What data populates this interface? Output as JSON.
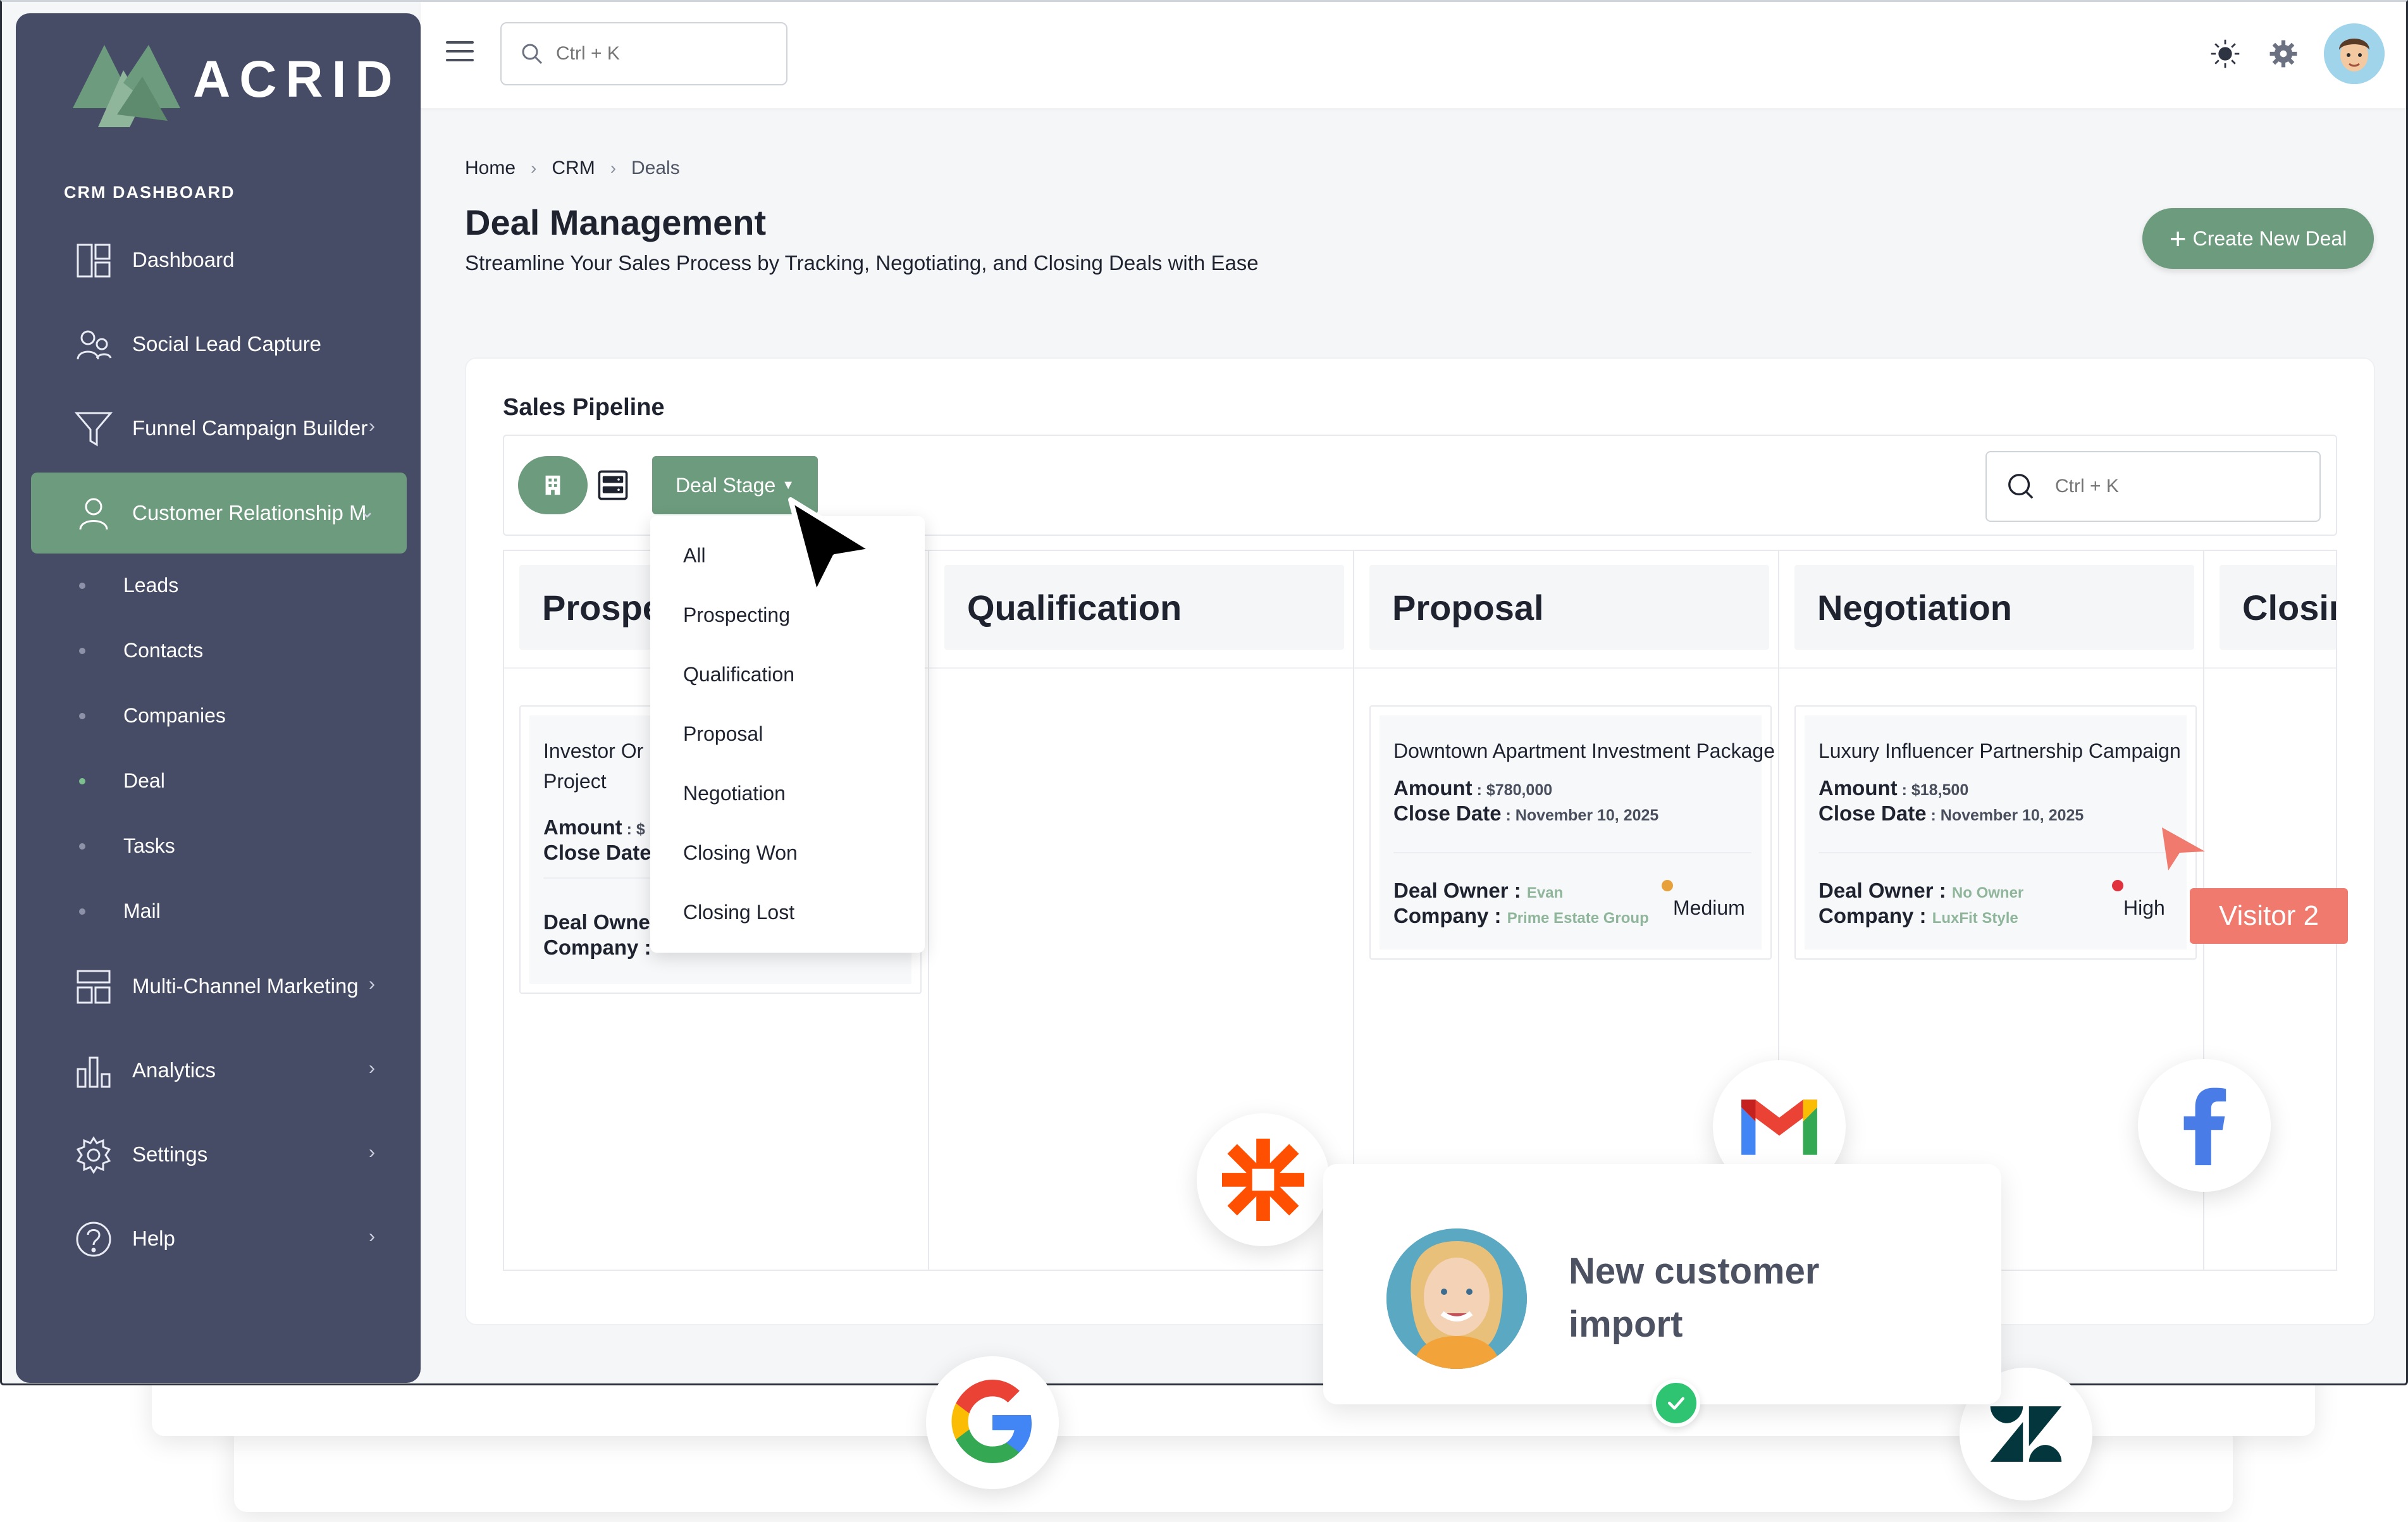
{
  "brand": {
    "name": "ACRID"
  },
  "sidebar": {
    "section_title": "CRM DASHBOARD",
    "items": [
      {
        "label": "Dashboard"
      },
      {
        "label": "Social Lead Capture"
      },
      {
        "label": "Funnel Campaign Builder"
      },
      {
        "label": "Customer Relationship M"
      },
      {
        "label": "Multi-Channel Marketing"
      },
      {
        "label": "Analytics"
      },
      {
        "label": "Settings"
      },
      {
        "label": "Help"
      }
    ],
    "sub_items": [
      {
        "label": "Leads"
      },
      {
        "label": "Contacts"
      },
      {
        "label": "Companies"
      },
      {
        "label": "Deal"
      },
      {
        "label": "Tasks"
      },
      {
        "label": "Mail"
      }
    ]
  },
  "topbar": {
    "search_placeholder": "Ctrl + K"
  },
  "breadcrumb": [
    "Home",
    "CRM",
    "Deals"
  ],
  "page": {
    "title": "Deal Management",
    "subtitle": "Streamline Your Sales Process by Tracking, Negotiating, and Closing Deals with Ease",
    "create_button": "Create New Deal"
  },
  "pipeline": {
    "title": "Sales Pipeline",
    "filter_label": "Deal Stage",
    "search_placeholder": "Ctrl + K",
    "columns": [
      "Prospecting",
      "Qualification",
      "Proposal",
      "Negotiation",
      "Closing Won"
    ],
    "dropdown_options": [
      "All",
      "Prospecting",
      "Qualification",
      "Proposal",
      "Negotiation",
      "Closing Won",
      "Closing Lost"
    ],
    "labels": {
      "amount": "Amount",
      "close_date": "Close Date",
      "deal_owner": "Deal Owner",
      "company": "Company"
    },
    "cards": [
      {
        "title_line1": "Investor Or",
        "title_line2": "Project",
        "amount": "$",
        "close_date": "",
        "owner": "",
        "company": ""
      },
      {
        "title": "Downtown Apartment Investment Package",
        "amount": "$780,000",
        "close_date": "November 10, 2025",
        "owner": "Evan",
        "company": "Prime Estate Group",
        "priority": "Medium",
        "priority_color": "#e8a13a"
      },
      {
        "title": "Luxury Influencer Partnership Campaign",
        "amount": "$18,500",
        "close_date": "November 10, 2025",
        "owner": "No Owner",
        "company": "LuxFit Style",
        "priority": "High",
        "priority_color": "#e0313c"
      }
    ]
  },
  "visitor": {
    "label": "Visitor 2",
    "color": "#f07a6e"
  },
  "notification": {
    "line1": "New customer",
    "line2": "import"
  },
  "integrations": [
    "zapier-icon",
    "gmail-icon",
    "facebook-icon",
    "google-icon",
    "zendesk-icon"
  ],
  "colors": {
    "sidebar": "#474c66",
    "accent": "#6d9b7d"
  }
}
